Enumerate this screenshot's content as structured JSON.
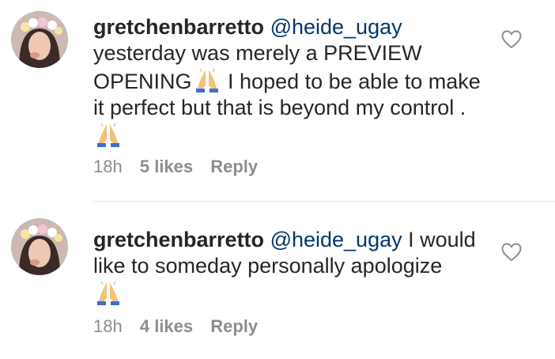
{
  "comments": [
    {
      "username": "gretchenbarretto",
      "mention": "@heide_ugay",
      "text_part1": "yesterday was merely a PREVIEW OPENING",
      "text_part2": " I hoped to be able to make it perfect but that is beyond my control .",
      "emojis": [
        "folded-hands-icon",
        "folded-hands-icon"
      ],
      "time": "18h",
      "likes": "5 likes",
      "reply": "Reply"
    },
    {
      "username": "gretchenbarretto",
      "mention": "@heide_ugay",
      "text_part1": " I would like to someday personally apologize",
      "text_part2": "",
      "emojis": [
        "folded-hands-icon"
      ],
      "time": "18h",
      "likes": "4 likes",
      "reply": "Reply"
    }
  ],
  "colors": {
    "text": "#262626",
    "mention": "#00376b",
    "meta": "#8e8e8e",
    "divider": "#e6e6e6"
  }
}
